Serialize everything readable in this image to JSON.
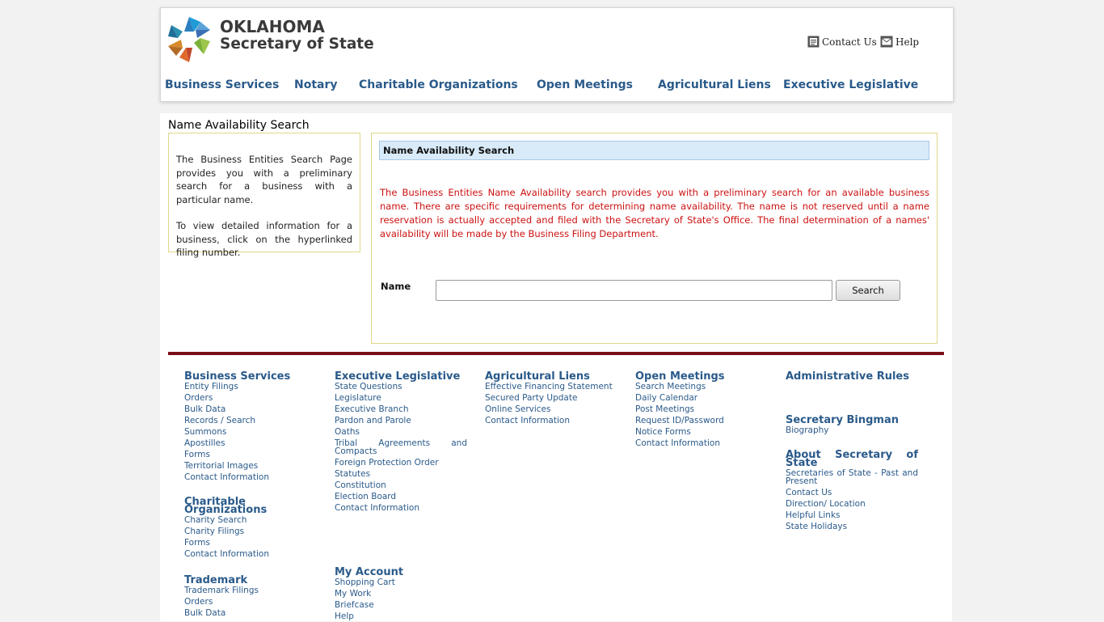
{
  "brand": {
    "line1": "OKLAHOMA",
    "line2": "Secretary of State"
  },
  "toplinks": {
    "contact": "Contact Us",
    "help": "Help"
  },
  "nav": [
    "Business Services",
    "Notary",
    "Charitable Organizations",
    "Open Meetings",
    "Agricultural Liens",
    "Executive Legislative"
  ],
  "page_title": "Name Availability Search",
  "info": {
    "p1": "The Business Entities Search Page provides you with a preliminary search for a business with a particular name.",
    "p2": "To view detailed information for a business, click on the hyperlinked filing number."
  },
  "search": {
    "heading": "Name Availability Search",
    "description": "The Business Entities Name Availability search provides you with a preliminary search for an available business name. There are specific requirements for determining name availability. The name is not reserved until a name reservation is actually accepted and filed with the Secretary of State's Office. The final determination of a names' availability will be made by the Business Filing Department.",
    "name_label": "Name",
    "name_value": "",
    "button": "Search"
  },
  "footer": {
    "business": {
      "title": "Business Services",
      "links": [
        "Entity Filings",
        "Orders",
        "Bulk Data",
        "Records / Search",
        "Summons",
        "Apostilles",
        "Forms",
        "Territorial Images",
        "Contact Information"
      ]
    },
    "charitable": {
      "title": "Charitable Organizations",
      "links": [
        "Charity Search",
        "Charity Filings",
        "Forms",
        "Contact Information"
      ]
    },
    "trademark": {
      "title": "Trademark",
      "links": [
        "Trademark Filings",
        "Orders",
        "Bulk Data"
      ]
    },
    "executive": {
      "title": "Executive Legislative",
      "links": [
        "State Questions",
        "Legislature",
        "Executive Branch",
        "Pardon and Parole",
        "Oaths",
        "Tribal Agreements and Compacts",
        "Foreign Protection Order",
        "Statutes",
        "Constitution",
        "Election Board",
        "Contact Information"
      ]
    },
    "account": {
      "title": "My Account",
      "links": [
        "Shopping Cart",
        "My Work",
        "Briefcase",
        "Help"
      ]
    },
    "liens": {
      "title": "Agricultural Liens",
      "links": [
        "Effective Financing Statement",
        "Secured Party Update",
        "Online Services",
        "Contact Information"
      ]
    },
    "meetings": {
      "title": "Open Meetings",
      "links": [
        "Search Meetings",
        "Daily Calendar",
        "Post Meetings",
        "Request ID/Password",
        "Notice Forms",
        "Contact Information"
      ]
    },
    "admin": {
      "title": "Administrative Rules"
    },
    "secretary": {
      "title": "Secretary Bingman",
      "links": [
        "Biography"
      ]
    },
    "about": {
      "title": "About Secretary of State",
      "links": [
        "Secretaries of State - Past and Present",
        "Contact Us",
        "Direction/ Location",
        "Helpful Links",
        "State Holidays"
      ]
    }
  }
}
